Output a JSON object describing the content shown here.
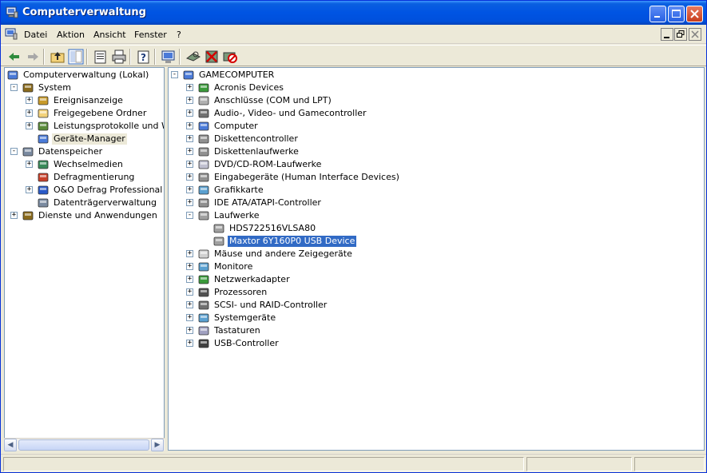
{
  "window": {
    "title": "Computerverwaltung"
  },
  "menu": [
    "Datei",
    "Aktion",
    "Ansicht",
    "Fenster",
    "?"
  ],
  "toolbar_icons": [
    "back-icon",
    "forward-icon",
    "up-folder-icon",
    "show-tree-icon",
    "properties-icon",
    "print-icon",
    "help-icon",
    "console-icon",
    "scan-hardware-icon",
    "uninstall-icon",
    "disable-device-icon"
  ],
  "left_tree": [
    {
      "label": "Computerverwaltung (Lokal)",
      "icon": "computer-management-icon",
      "level": 0,
      "exp": ""
    },
    {
      "label": "System",
      "icon": "system-tools-icon",
      "level": 1,
      "exp": "-"
    },
    {
      "label": "Ereignisanzeige",
      "icon": "event-viewer-icon",
      "level": 2,
      "exp": "+"
    },
    {
      "label": "Freigegebene Ordner",
      "icon": "shared-folder-icon",
      "level": 2,
      "exp": "+"
    },
    {
      "label": "Leistungsprotokolle und Warn",
      "icon": "performance-logs-icon",
      "level": 2,
      "exp": "+"
    },
    {
      "label": "Geräte-Manager",
      "icon": "device-manager-icon",
      "level": 2,
      "exp": "",
      "selected": true
    },
    {
      "label": "Datenspeicher",
      "icon": "storage-icon",
      "level": 1,
      "exp": "-"
    },
    {
      "label": "Wechselmedien",
      "icon": "removable-storage-icon",
      "level": 2,
      "exp": "+"
    },
    {
      "label": "Defragmentierung",
      "icon": "defrag-icon",
      "level": 2,
      "exp": ""
    },
    {
      "label": "O&O Defrag Professional Edi",
      "icon": "oo-defrag-icon",
      "level": 2,
      "exp": "+"
    },
    {
      "label": "Datenträgerverwaltung",
      "icon": "disk-management-icon",
      "level": 2,
      "exp": ""
    },
    {
      "label": "Dienste und Anwendungen",
      "icon": "services-icon",
      "level": 1,
      "exp": "+"
    }
  ],
  "right_tree": [
    {
      "label": "GAMECOMPUTER",
      "icon": "computer-icon",
      "level": 0,
      "exp": "-"
    },
    {
      "label": "Acronis Devices",
      "icon": "acronis-icon",
      "level": 1,
      "exp": "+"
    },
    {
      "label": "Anschlüsse (COM und LPT)",
      "icon": "port-icon",
      "level": 1,
      "exp": "+"
    },
    {
      "label": "Audio-, Video- und Gamecontroller",
      "icon": "audio-icon",
      "level": 1,
      "exp": "+"
    },
    {
      "label": "Computer",
      "icon": "computer-icon",
      "level": 1,
      "exp": "+"
    },
    {
      "label": "Diskettencontroller",
      "icon": "floppy-controller-icon",
      "level": 1,
      "exp": "+"
    },
    {
      "label": "Diskettenlaufwerke",
      "icon": "floppy-drive-icon",
      "level": 1,
      "exp": "+"
    },
    {
      "label": "DVD/CD-ROM-Laufwerke",
      "icon": "cdrom-icon",
      "level": 1,
      "exp": "+"
    },
    {
      "label": "Eingabegeräte (Human Interface Devices)",
      "icon": "hid-icon",
      "level": 1,
      "exp": "+"
    },
    {
      "label": "Grafikkarte",
      "icon": "display-adapter-icon",
      "level": 1,
      "exp": "+"
    },
    {
      "label": "IDE ATA/ATAPI-Controller",
      "icon": "ide-controller-icon",
      "level": 1,
      "exp": "+"
    },
    {
      "label": "Laufwerke",
      "icon": "disk-drive-icon",
      "level": 1,
      "exp": "-"
    },
    {
      "label": "HDS722516VLSA80",
      "icon": "disk-drive-icon",
      "level": 2,
      "exp": ""
    },
    {
      "label": "Maxtor 6Y160P0 USB Device",
      "icon": "disk-drive-icon",
      "level": 2,
      "exp": "",
      "selected": true
    },
    {
      "label": "Mäuse und andere Zeigegeräte",
      "icon": "mouse-icon",
      "level": 1,
      "exp": "+"
    },
    {
      "label": "Monitore",
      "icon": "monitor-icon",
      "level": 1,
      "exp": "+"
    },
    {
      "label": "Netzwerkadapter",
      "icon": "network-adapter-icon",
      "level": 1,
      "exp": "+"
    },
    {
      "label": "Prozessoren",
      "icon": "processor-icon",
      "level": 1,
      "exp": "+"
    },
    {
      "label": "SCSI- und RAID-Controller",
      "icon": "scsi-icon",
      "level": 1,
      "exp": "+"
    },
    {
      "label": "Systemgeräte",
      "icon": "system-devices-icon",
      "level": 1,
      "exp": "+"
    },
    {
      "label": "Tastaturen",
      "icon": "keyboard-icon",
      "level": 1,
      "exp": "+"
    },
    {
      "label": "USB-Controller",
      "icon": "usb-icon",
      "level": 1,
      "exp": "+"
    }
  ],
  "colors": {
    "titlebar": "#0054e3",
    "selection": "#316ac5",
    "chrome": "#ece9d8"
  }
}
